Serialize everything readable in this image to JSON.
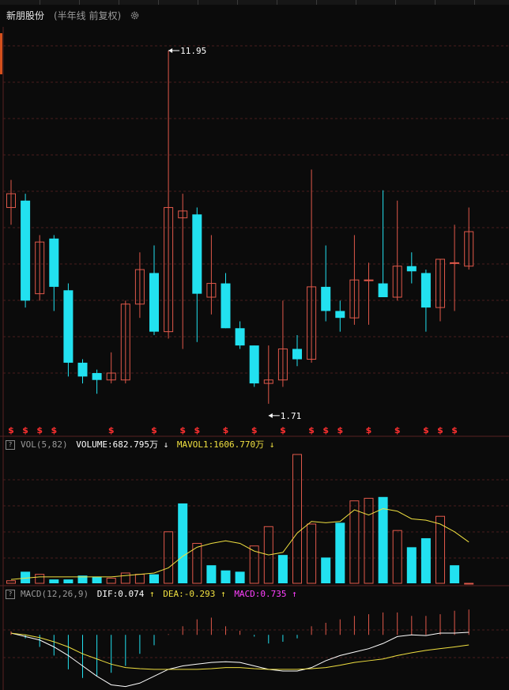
{
  "header": {
    "stock_name": "新朋股份",
    "period_label": "(半年线 前复权)"
  },
  "icons": {
    "settings": "gear-icon",
    "help": "question-box-icon"
  },
  "colors": {
    "up": "#e0584a",
    "down": "#22e1f0",
    "grid": "#4a1c1c",
    "vol_ma": "#f0e040",
    "dif": "#ffffff",
    "dea": "#f0e040",
    "macd_label": "#ff40ff"
  },
  "annotations": {
    "high": "11.95",
    "low": "1.71",
    "marker_glyph": "$"
  },
  "volume_panel": {
    "label": "VOL(5,82)",
    "volume_text": "VOLUME:682.795万",
    "volume_arrow": "↓",
    "mavol_text": "MAVOL1:1606.770万",
    "mavol_arrow": "↓"
  },
  "macd_panel": {
    "label": "MACD(12,26,9)",
    "dif_text": "DIF:0.074",
    "dif_arrow": "↑",
    "dea_text": "DEA:-0.293",
    "dea_arrow": "↑",
    "macd_text": "MACD:0.735",
    "macd_arrow": "↑"
  },
  "chart_data": [
    {
      "type": "candlestick",
      "ylim": [
        1.5,
        12.5
      ],
      "candles": [
        {
          "o": 7.4,
          "h": 8.2,
          "l": 6.9,
          "c": 7.8
        },
        {
          "o": 7.6,
          "h": 7.8,
          "l": 4.5,
          "c": 4.7
        },
        {
          "o": 4.9,
          "h": 6.6,
          "l": 4.7,
          "c": 6.4
        },
        {
          "o": 6.5,
          "h": 6.6,
          "l": 4.4,
          "c": 5.1
        },
        {
          "o": 5.0,
          "h": 5.2,
          "l": 2.5,
          "c": 2.9
        },
        {
          "o": 2.9,
          "h": 3.0,
          "l": 2.3,
          "c": 2.5
        },
        {
          "o": 2.6,
          "h": 2.7,
          "l": 2.0,
          "c": 2.4
        },
        {
          "o": 2.4,
          "h": 3.2,
          "l": 2.3,
          "c": 2.6
        },
        {
          "o": 2.4,
          "h": 4.7,
          "l": 2.3,
          "c": 4.6
        },
        {
          "o": 4.6,
          "h": 6.1,
          "l": 4.2,
          "c": 5.6
        },
        {
          "o": 5.5,
          "h": 6.3,
          "l": 3.7,
          "c": 3.8
        },
        {
          "o": 3.8,
          "h": 11.95,
          "l": 3.6,
          "c": 7.4
        },
        {
          "o": 7.1,
          "h": 7.8,
          "l": 3.3,
          "c": 7.3
        },
        {
          "o": 7.2,
          "h": 7.4,
          "l": 3.5,
          "c": 4.9
        },
        {
          "o": 4.8,
          "h": 6.6,
          "l": 4.3,
          "c": 5.2
        },
        {
          "o": 5.2,
          "h": 5.5,
          "l": 3.9,
          "c": 3.9
        },
        {
          "o": 3.9,
          "h": 4.1,
          "l": 3.3,
          "c": 3.4
        },
        {
          "o": 3.4,
          "h": 3.4,
          "l": 2.2,
          "c": 2.3
        },
        {
          "o": 2.3,
          "h": 3.4,
          "l": 1.71,
          "c": 2.4
        },
        {
          "o": 2.4,
          "h": 4.7,
          "l": 2.2,
          "c": 3.3
        },
        {
          "o": 3.3,
          "h": 3.7,
          "l": 2.8,
          "c": 3.0
        },
        {
          "o": 3.0,
          "h": 8.5,
          "l": 2.9,
          "c": 5.1
        },
        {
          "o": 5.1,
          "h": 6.3,
          "l": 4.1,
          "c": 4.4
        },
        {
          "o": 4.4,
          "h": 4.7,
          "l": 3.8,
          "c": 4.2
        },
        {
          "o": 4.2,
          "h": 6.6,
          "l": 4.0,
          "c": 5.3
        },
        {
          "o": 5.3,
          "h": 5.8,
          "l": 4.0,
          "c": 5.3
        },
        {
          "o": 5.2,
          "h": 7.9,
          "l": 4.8,
          "c": 4.8
        },
        {
          "o": 4.8,
          "h": 7.6,
          "l": 4.7,
          "c": 5.7
        },
        {
          "o": 5.7,
          "h": 6.1,
          "l": 5.2,
          "c": 5.55
        },
        {
          "o": 5.5,
          "h": 5.6,
          "l": 3.8,
          "c": 4.5
        },
        {
          "o": 4.5,
          "h": 5.9,
          "l": 4.1,
          "c": 5.9
        },
        {
          "o": 5.8,
          "h": 6.9,
          "l": 4.4,
          "c": 5.8
        },
        {
          "o": 5.7,
          "h": 7.4,
          "l": 5.6,
          "c": 6.7
        }
      ],
      "marker_indices": [
        0,
        1,
        2,
        3,
        7,
        10,
        12,
        13,
        15,
        17,
        19,
        21,
        22,
        23,
        25,
        27,
        29,
        30,
        31
      ]
    },
    {
      "type": "bar",
      "title": "VOL(5,82)",
      "ylim": [
        0,
        100
      ],
      "directions": [
        "up",
        "down",
        "up",
        "down",
        "down",
        "down",
        "down",
        "up",
        "up",
        "up",
        "down",
        "up",
        "down",
        "up",
        "down",
        "down",
        "down",
        "up",
        "up",
        "down",
        "up",
        "up",
        "down",
        "down",
        "up",
        "up",
        "down",
        "up",
        "down",
        "down",
        "up",
        "down",
        "up"
      ],
      "values": [
        2,
        9,
        7,
        3,
        3,
        6,
        5,
        4,
        8,
        7,
        7,
        40,
        62,
        31,
        14,
        10,
        9,
        29,
        44,
        22,
        100,
        46,
        20,
        47,
        64,
        66,
        67,
        41,
        28,
        35,
        52,
        14,
        0
      ],
      "ma_line": [
        3,
        4,
        5,
        5,
        5,
        5,
        5,
        5,
        6,
        7,
        8,
        12,
        21,
        28,
        31,
        33,
        31,
        25,
        22,
        24,
        39,
        48,
        47,
        48,
        57,
        53,
        58,
        56,
        50,
        49,
        46,
        40,
        32
      ]
    },
    {
      "type": "bar",
      "title": "MACD(12,26,9)",
      "ylim": [
        -1.6,
        0.9
      ],
      "directions": [
        "up",
        "down",
        "down",
        "down",
        "down",
        "down",
        "down",
        "down",
        "down",
        "down",
        "down",
        "up",
        "up",
        "up",
        "up",
        "up",
        "up",
        "down",
        "down",
        "down",
        "down",
        "up",
        "up",
        "up",
        "up",
        "up",
        "up",
        "up",
        "up",
        "up",
        "up",
        "up",
        "up"
      ],
      "histogram": [
        0.1,
        -0.1,
        -0.35,
        -0.6,
        -1.0,
        -1.25,
        -1.2,
        -1.1,
        -0.9,
        -0.55,
        -0.3,
        0.02,
        0.25,
        0.45,
        0.5,
        0.25,
        0.12,
        -0.05,
        -0.25,
        -0.2,
        -0.1,
        0.25,
        0.35,
        0.45,
        0.55,
        0.6,
        0.65,
        0.65,
        0.55,
        0.55,
        0.6,
        0.7,
        0.735
      ],
      "dif": [
        0.05,
        -0.05,
        -0.15,
        -0.35,
        -0.6,
        -0.9,
        -1.2,
        -1.45,
        -1.5,
        -1.4,
        -1.2,
        -1.0,
        -0.9,
        -0.85,
        -0.8,
        -0.78,
        -0.8,
        -0.9,
        -1.0,
        -1.05,
        -1.05,
        -0.95,
        -0.75,
        -0.6,
        -0.5,
        -0.4,
        -0.25,
        -0.05,
        0.0,
        -0.02,
        0.05,
        0.05,
        0.074
      ],
      "dea": [
        0.05,
        0.0,
        -0.08,
        -0.2,
        -0.35,
        -0.55,
        -0.7,
        -0.85,
        -0.95,
        -0.98,
        -1.0,
        -1.0,
        -1.0,
        -1.0,
        -0.98,
        -0.95,
        -0.95,
        -0.98,
        -1.0,
        -1.0,
        -1.0,
        -0.98,
        -0.95,
        -0.88,
        -0.8,
        -0.75,
        -0.7,
        -0.6,
        -0.52,
        -0.45,
        -0.4,
        -0.35,
        -0.293
      ]
    }
  ]
}
